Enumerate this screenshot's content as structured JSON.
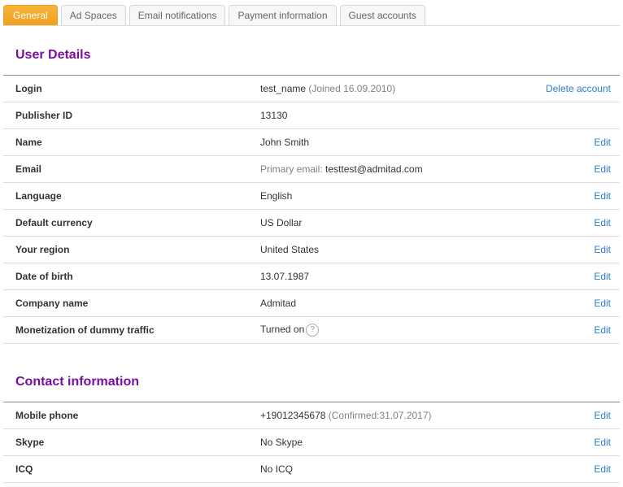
{
  "tabs": [
    {
      "label": "General",
      "active": true
    },
    {
      "label": "Ad Spaces",
      "active": false
    },
    {
      "label": "Email notifications",
      "active": false
    },
    {
      "label": "Payment information",
      "active": false
    },
    {
      "label": "Guest accounts",
      "active": false
    }
  ],
  "user_details": {
    "title": "User Details",
    "rows": [
      {
        "label": "Login",
        "value": "test_name",
        "note": "(Joined 16.09.2010)",
        "action": "Delete account"
      },
      {
        "label": "Publisher ID",
        "value": "13130"
      },
      {
        "label": "Name",
        "value": "John Smith",
        "action": "Edit"
      },
      {
        "label": "Email",
        "prefix": "Primary email:",
        "value": "testtest@admitad.com",
        "action": "Edit"
      },
      {
        "label": "Language",
        "value": "English",
        "action": "Edit"
      },
      {
        "label": "Default currency",
        "value": "US Dollar",
        "action": "Edit"
      },
      {
        "label": "Your region",
        "value": "United States",
        "action": "Edit"
      },
      {
        "label": "Date of birth",
        "value": "13.07.1987",
        "action": "Edit"
      },
      {
        "label": "Company name",
        "value": "Admitad",
        "action": "Edit"
      },
      {
        "label": "Monetization of dummy traffic",
        "value": "Turned on",
        "help": "?",
        "action": "Edit"
      }
    ]
  },
  "contact_information": {
    "title": "Contact information",
    "rows": [
      {
        "label": "Mobile phone",
        "value": "+19012345678",
        "note": "(Confirmed:31.07.2017)",
        "action": "Edit"
      },
      {
        "label": "Skype",
        "value": "No Skype",
        "action": "Edit"
      },
      {
        "label": "ICQ",
        "value": "No ICQ",
        "action": "Edit"
      }
    ]
  },
  "colors": {
    "accent_tab": "#f0a020",
    "section_title": "#7a0ea3",
    "link": "#2a7fd4"
  }
}
